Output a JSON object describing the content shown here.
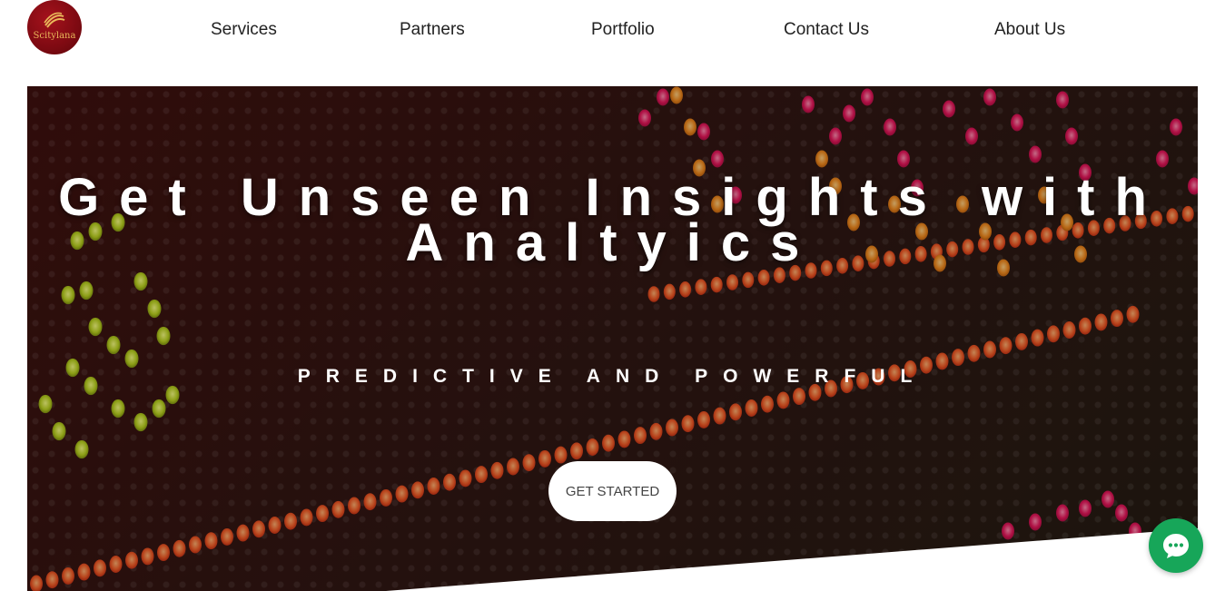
{
  "brand": {
    "logo_text": "Scitylana",
    "logo_color": "#7e0a12",
    "logo_text_color": "#e9b85a"
  },
  "nav": {
    "items": [
      {
        "label": "Services"
      },
      {
        "label": "Partners"
      },
      {
        "label": "Portfolio"
      },
      {
        "label": "Contact Us"
      },
      {
        "label": "About Us"
      }
    ]
  },
  "hero": {
    "title": "Get Unseen Insights with Analtyics",
    "subtitle": "PREDICTIVE AND POWERFUL",
    "cta_label": "GET STARTED"
  },
  "chat": {
    "icon": "chat-bubble-icon",
    "color": "#17a659"
  },
  "colors": {
    "nav_text": "#222222",
    "hero_text": "#ffffff",
    "cta_text": "#444444"
  }
}
